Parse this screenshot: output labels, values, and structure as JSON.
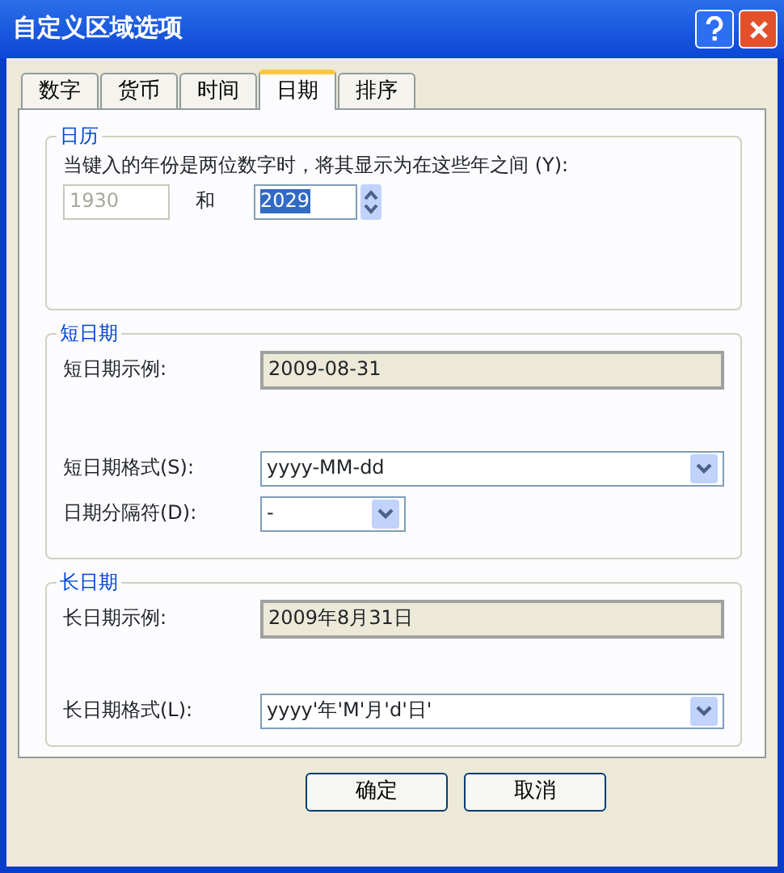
{
  "window": {
    "title": "自定义区域选项"
  },
  "tabs": [
    {
      "label": "数字",
      "selected": false
    },
    {
      "label": "货币",
      "selected": false
    },
    {
      "label": "时间",
      "selected": false
    },
    {
      "label": "日期",
      "selected": true
    },
    {
      "label": "排序",
      "selected": false
    }
  ],
  "calendar": {
    "title": "日历",
    "label": "当键入的年份是两位数字时，将其显示为在这些年之间 (Y):",
    "from_year": {
      "value": "1930",
      "disabled": true
    },
    "conjunction": "和",
    "to_year": {
      "value": "2029",
      "highlighted": true
    }
  },
  "short_date": {
    "title": "短日期",
    "example_label": "短日期示例:",
    "example": "2009-08-31",
    "format_label": "短日期格式(S):",
    "format": "yyyy-MM-dd",
    "separator_label": "日期分隔符(D):",
    "separator": "-"
  },
  "long_date": {
    "title": "长日期",
    "example_label": "长日期示例:",
    "example": "2009年8月31日",
    "format_label": "长日期格式(L):",
    "format": "yyyy'年'M'月'd'日'"
  },
  "buttons": [
    "确定",
    "取消"
  ]
}
